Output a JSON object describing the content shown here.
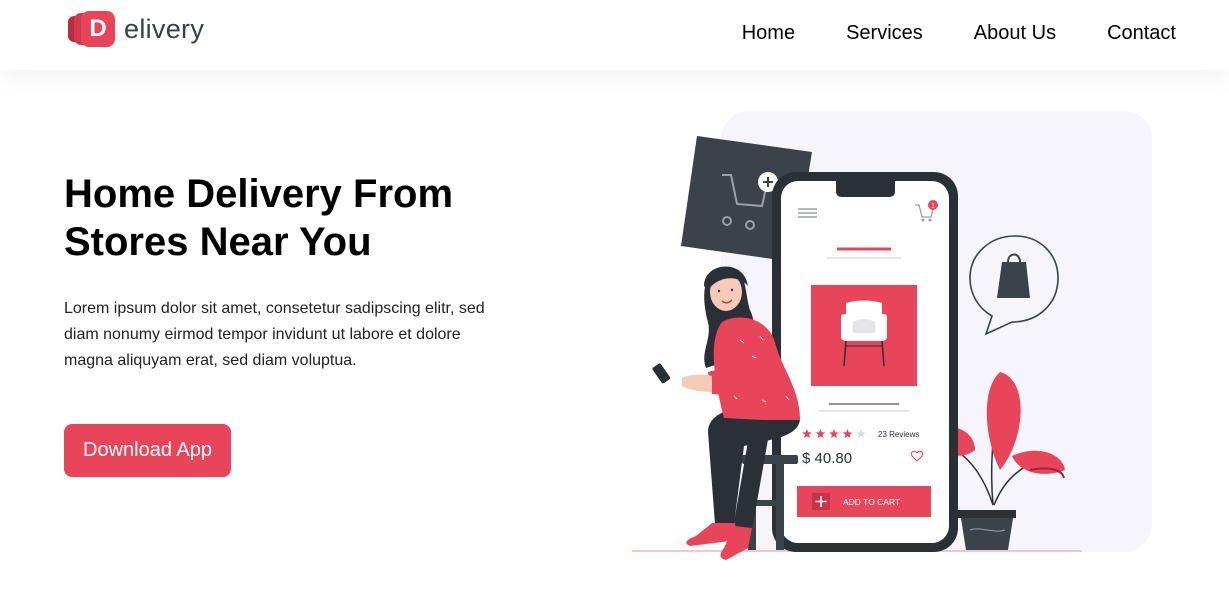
{
  "header": {
    "logo": {
      "letter": "D",
      "text": "elivery"
    },
    "nav": [
      "Home",
      "Services",
      "About Us",
      "Contact"
    ]
  },
  "hero": {
    "title": "Home Delivery From Stores Near You",
    "description": "Lorem ipsum dolor sit amet, consetetur sadipscing elitr, sed diam nonumy eirmod tempor invidunt ut labore et dolore magna aliquyam erat, sed diam voluptua.",
    "cta_label": "Download App"
  },
  "illustration": {
    "phone": {
      "cart_count": "1",
      "reviews": "23 Reviews",
      "price": "$ 40.80",
      "add_to_cart": "ADD TO CART",
      "rating": 4,
      "rating_max": 5
    },
    "colors": {
      "accent": "#e8455b",
      "dark": "#3c4249",
      "panel": "#f5f5fb"
    }
  }
}
